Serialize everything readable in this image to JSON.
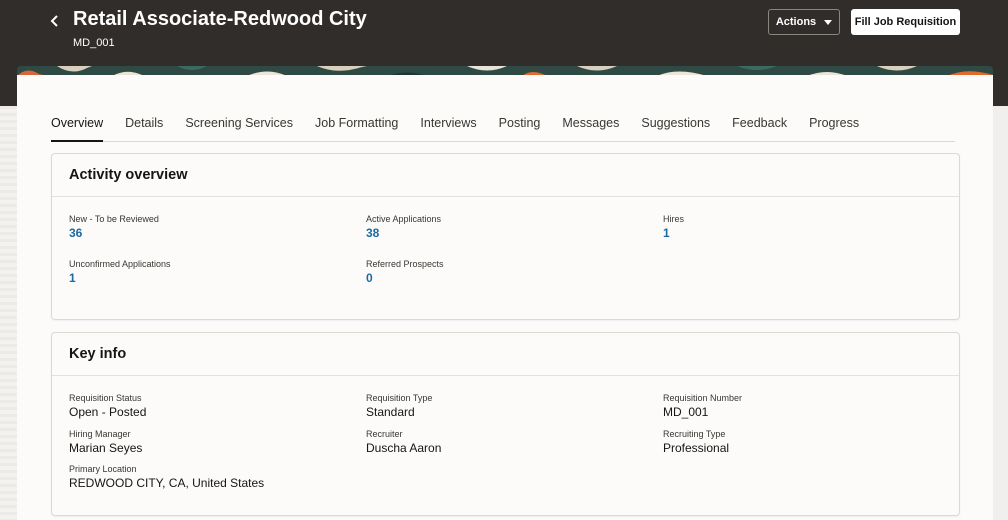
{
  "header": {
    "title": "Retail Associate-Redwood City",
    "subtitle": "MD_001",
    "actions_label": "Actions",
    "fill_label": "Fill Job Requisition"
  },
  "tabs": [
    {
      "label": "Overview",
      "active": true
    },
    {
      "label": "Details"
    },
    {
      "label": "Screening Services"
    },
    {
      "label": "Job Formatting"
    },
    {
      "label": "Interviews"
    },
    {
      "label": "Posting"
    },
    {
      "label": "Messages"
    },
    {
      "label": "Suggestions"
    },
    {
      "label": "Feedback"
    },
    {
      "label": "Progress"
    }
  ],
  "activity": {
    "title": "Activity overview",
    "metrics": [
      {
        "label": "New - To be Reviewed",
        "value": "36"
      },
      {
        "label": "Active Applications",
        "value": "38"
      },
      {
        "label": "Hires",
        "value": "1"
      },
      {
        "label": "Unconfirmed Applications",
        "value": "1"
      },
      {
        "label": "Referred Prospects",
        "value": "0"
      }
    ]
  },
  "keyinfo": {
    "title": "Key info",
    "fields": [
      {
        "label": "Requisition Status",
        "value": "Open - Posted"
      },
      {
        "label": "Requisition Type",
        "value": "Standard"
      },
      {
        "label": "Requisition Number",
        "value": "MD_001"
      },
      {
        "label": "Hiring Manager",
        "value": "Marian Seyes"
      },
      {
        "label": "Recruiter",
        "value": "Duscha Aaron"
      },
      {
        "label": "Recruiting Type",
        "value": "Professional"
      },
      {
        "label": "Primary Location",
        "value": "REDWOOD CITY, CA, United States"
      }
    ]
  },
  "icons": {
    "back": "chevron-left-icon",
    "dropdown": "caret-down-icon"
  },
  "colors": {
    "header_bg": "#312d2a",
    "link": "#1b6aa0"
  }
}
